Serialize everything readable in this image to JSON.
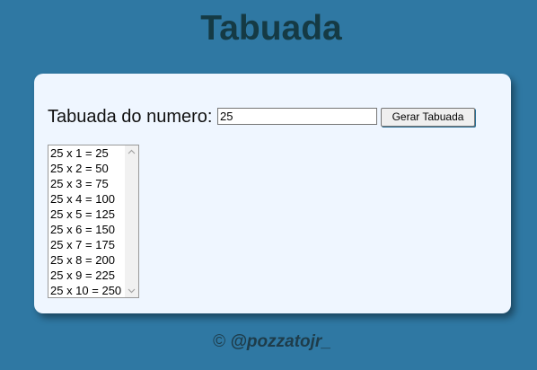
{
  "page": {
    "title": "Tabuada"
  },
  "form": {
    "label": "Tabuada do numero:",
    "input_value": "25",
    "button_label": "Gerar Tabuada"
  },
  "results": {
    "items": [
      "25 x 1 = 25",
      "25 x 2 = 50",
      "25 x 3 = 75",
      "25 x 4 = 100",
      "25 x 5 = 125",
      "25 x 6 = 150",
      "25 x 7 = 175",
      "25 x 8 = 200",
      "25 x 9 = 225",
      "25 x 10 = 250"
    ]
  },
  "footer": {
    "copyright_symbol": "©",
    "handle": "@pozzatojr_"
  },
  "colors": {
    "background": "#2f78a3",
    "card": "#eff6ff",
    "title": "#153a44"
  }
}
